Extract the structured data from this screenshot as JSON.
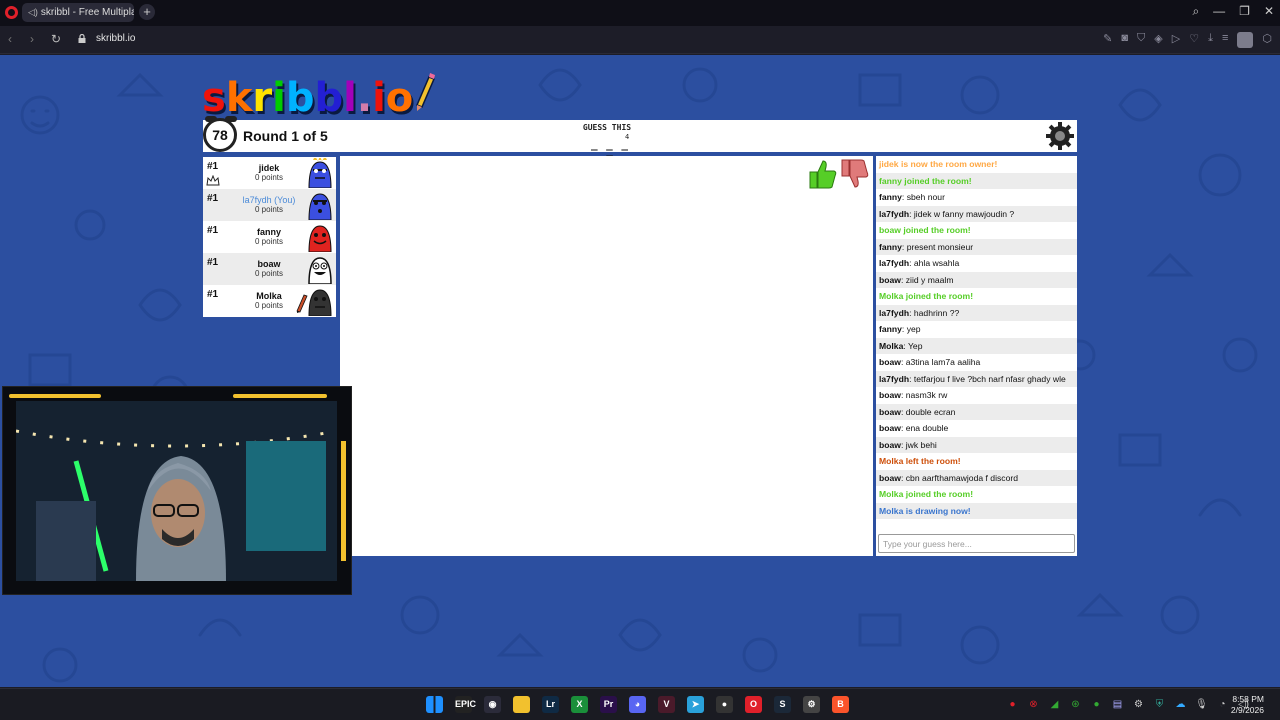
{
  "browser": {
    "tab_title": "skribbl - Free Multiplayer",
    "new_tab": "+",
    "url": "skribbl.io"
  },
  "game": {
    "logo_text": [
      "s",
      "k",
      "r",
      "i",
      "b",
      "b",
      "l",
      ".",
      "i",
      "o"
    ],
    "logo_colors": [
      "#ef130b",
      "#ff7100",
      "#ffe400",
      "#00cc00",
      "#00b2ff",
      "#231fd3",
      "#a300ba",
      "#d37caa",
      "#ef130b",
      "#ff7100"
    ],
    "timer": "78",
    "round_label": "Round 1 of 5",
    "guess_label": "GUESS THIS",
    "word_length": "4",
    "word_hint": "_ _ _ _"
  },
  "players": [
    {
      "rank": "#1",
      "name": "jidek",
      "points": "0 points",
      "color": "#3b4fe0",
      "owner": true,
      "drawing": false,
      "you": false
    },
    {
      "rank": "#1",
      "name": "la7fydh (You)",
      "points": "0 points",
      "color": "#3b4fe0",
      "owner": false,
      "drawing": false,
      "you": true
    },
    {
      "rank": "#1",
      "name": "fanny",
      "points": "0 points",
      "color": "#e0231f",
      "owner": false,
      "drawing": false,
      "you": false
    },
    {
      "rank": "#1",
      "name": "boaw",
      "points": "0 points",
      "color": "#ffffff",
      "owner": false,
      "drawing": false,
      "you": false
    },
    {
      "rank": "#1",
      "name": "Molka",
      "points": "0 points",
      "color": "#333333",
      "owner": false,
      "drawing": true,
      "you": false
    }
  ],
  "chat": {
    "messages": [
      {
        "type": "owner",
        "text": "jidek is now the room owner!"
      },
      {
        "type": "join",
        "text": "fanny joined the room!"
      },
      {
        "type": "msg",
        "user": "fanny",
        "text": "sbeh nour"
      },
      {
        "type": "msg",
        "user": "la7fydh",
        "text": "jidek w fanny mawjoudin ?"
      },
      {
        "type": "join",
        "text": "boaw joined the room!"
      },
      {
        "type": "msg",
        "user": "fanny",
        "text": "present monsieur"
      },
      {
        "type": "msg",
        "user": "la7fydh",
        "text": "ahla wsahla"
      },
      {
        "type": "msg",
        "user": "boaw",
        "text": "ziid y maalm"
      },
      {
        "type": "join",
        "text": "Molka joined the room!"
      },
      {
        "type": "msg",
        "user": "la7fydh",
        "text": "hadhrinn ??"
      },
      {
        "type": "msg",
        "user": "fanny",
        "text": "yep"
      },
      {
        "type": "msg",
        "user": "Molka",
        "text": "Yep"
      },
      {
        "type": "msg",
        "user": "boaw",
        "text": "a3tina lam7a aaliha"
      },
      {
        "type": "msg",
        "user": "la7fydh",
        "text": "tetfarjou f live ?bch narf nfasr ghady wle"
      },
      {
        "type": "msg",
        "user": "boaw",
        "text": "nasm3k rw"
      },
      {
        "type": "msg",
        "user": "boaw",
        "text": "double ecran"
      },
      {
        "type": "msg",
        "user": "boaw",
        "text": "ena double"
      },
      {
        "type": "msg",
        "user": "boaw",
        "text": "jwk behi"
      },
      {
        "type": "leave",
        "text": "Molka left the room!"
      },
      {
        "type": "msg",
        "user": "boaw",
        "text": "cbn aarfthamawjoda f discord"
      },
      {
        "type": "join",
        "text": "Molka joined the room!"
      },
      {
        "type": "draw",
        "text": "Molka is drawing now!"
      }
    ],
    "input_placeholder": "Type your guess here..."
  },
  "taskbar": {
    "icons": [
      {
        "name": "windows-start-icon",
        "color": "#1e90ff",
        "glyph": ""
      },
      {
        "name": "epic-games-icon",
        "color": "#222",
        "glyph": "EPIC"
      },
      {
        "name": "davinci-icon",
        "color": "#2b2b3a",
        "glyph": "◉"
      },
      {
        "name": "file-explorer-icon",
        "color": "#f2c12e",
        "glyph": ""
      },
      {
        "name": "lightroom-icon",
        "color": "#0f2a44",
        "glyph": "Lr"
      },
      {
        "name": "xbox-icon",
        "color": "#1a8f3a",
        "glyph": "X"
      },
      {
        "name": "premiere-icon",
        "color": "#2a0f4a",
        "glyph": "Pr"
      },
      {
        "name": "discord-icon",
        "color": "#5865f2",
        "glyph": "◕"
      },
      {
        "name": "vegas-icon",
        "color": "#4a1a2a",
        "glyph": "V"
      },
      {
        "name": "telegram-icon",
        "color": "#2aa1da",
        "glyph": "➤"
      },
      {
        "name": "obs-icon",
        "color": "#333",
        "glyph": "●"
      },
      {
        "name": "opera-icon",
        "color": "#e0202a",
        "glyph": "O"
      },
      {
        "name": "steam-icon",
        "color": "#1b2838",
        "glyph": "S"
      },
      {
        "name": "settings-app-icon",
        "color": "#444",
        "glyph": "⚙"
      },
      {
        "name": "brave-icon",
        "color": "#fb542b",
        "glyph": "B"
      }
    ],
    "time": "8:58 PM",
    "date": "2/9/2026"
  }
}
